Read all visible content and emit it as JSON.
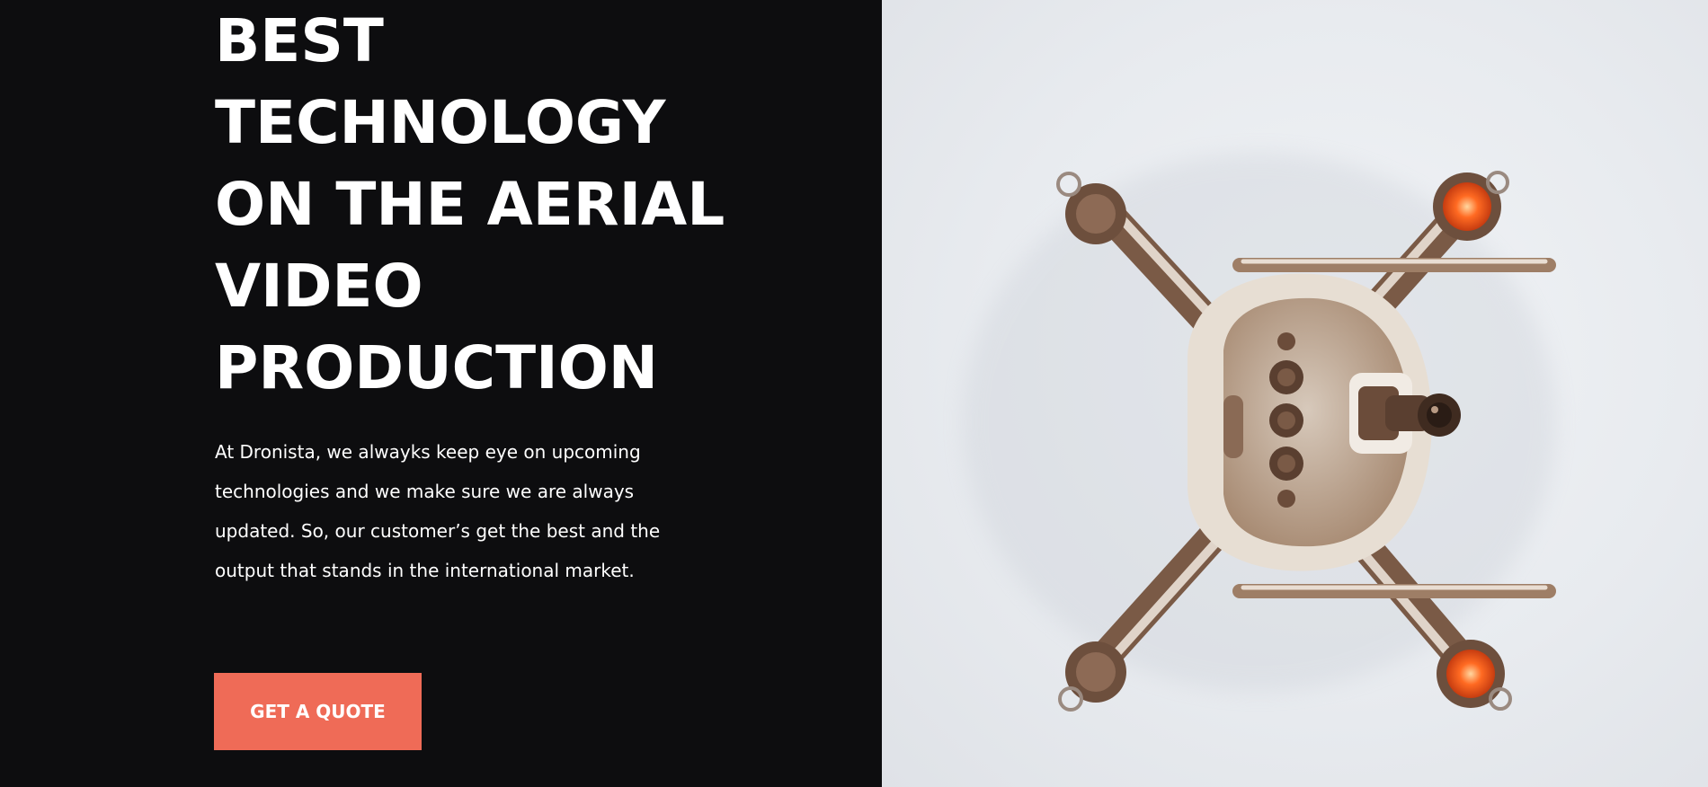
{
  "hero": {
    "heading_lines": [
      "BEST",
      "TECHNOLOGY",
      "ON THE AERIAL",
      "VIDEO",
      "PRODUCTION"
    ],
    "paragraph_lines": [
      "At Dronista, we alwayks keep eye on upcoming",
      "technologies and we make sure we are always",
      "updated. So, our customer’s get the best and the",
      "output that stands in the international market."
    ],
    "cta_label": "GET A QUOTE"
  },
  "image": {
    "subject": "drone-top-view",
    "background_color": "#e8ebef",
    "accent_light_color": "#ff5a1f"
  },
  "colors": {
    "left_background": "#0d0d0f",
    "heading_text": "#ffffff",
    "button_background": "#ef6b57",
    "button_text": "#ffffff"
  }
}
